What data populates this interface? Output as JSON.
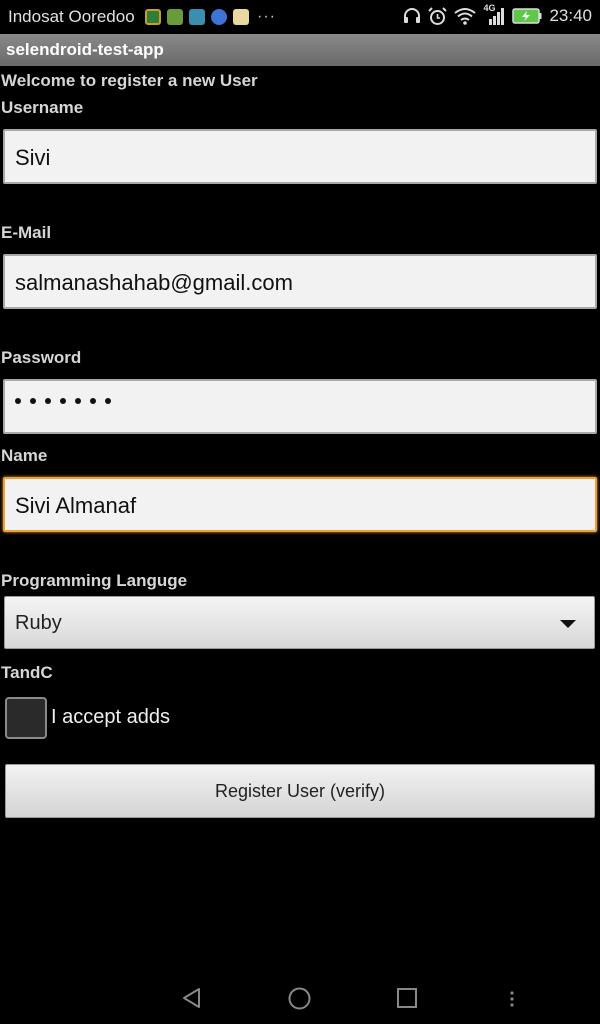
{
  "status_bar": {
    "carrier": "Indosat Ooredoo",
    "more_indicator": "···",
    "network_type": "4G",
    "time": "23:40",
    "icons": [
      "shield-app-icon",
      "android-app-icon",
      "message-app-icon",
      "google-icon",
      "gallery-app-icon",
      "headphones-icon",
      "alarm-icon",
      "wifi-icon",
      "signal-icon",
      "battery-charging-icon"
    ]
  },
  "app": {
    "title": "selendroid-test-app"
  },
  "form": {
    "welcome": "Welcome to register a new User",
    "username": {
      "label": "Username",
      "value": "Sivi"
    },
    "email": {
      "label": "E-Mail",
      "value": "salmanashahab@gmail.com"
    },
    "password": {
      "label": "Password",
      "masked_length": 7
    },
    "name": {
      "label": "Name",
      "value": "Sivi Almanaf"
    },
    "language": {
      "label": "Programming Languge",
      "selected": "Ruby"
    },
    "tandc": {
      "label": "TandC",
      "checkbox_label": "I accept adds",
      "checked": false
    },
    "register_button": "Register User (verify)"
  },
  "colors": {
    "focus_accent": "#f0a030",
    "title_bar": "#7a7a7a",
    "battery": "#5fc84a"
  },
  "nav_bar": {
    "icons": [
      "back-icon",
      "home-icon",
      "recents-icon",
      "menu-icon"
    ]
  }
}
